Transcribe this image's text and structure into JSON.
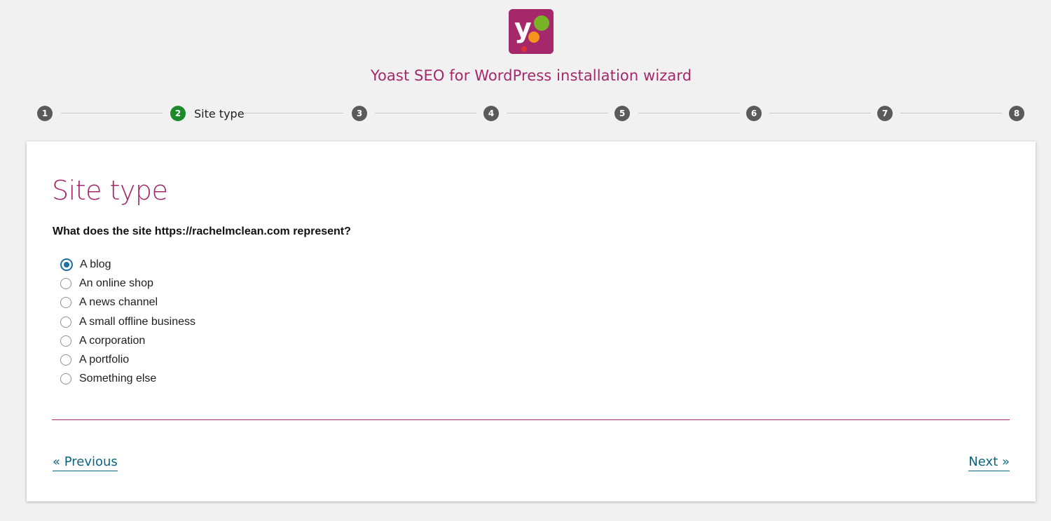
{
  "header": {
    "title": "Yoast SEO for WordPress installation wizard",
    "logo_icon": "yoast-logo-icon",
    "brand_color": "#a4286a"
  },
  "stepper": {
    "steps": [
      {
        "number": "1",
        "label": ""
      },
      {
        "number": "2",
        "label": "Site type",
        "active": true
      },
      {
        "number": "3",
        "label": ""
      },
      {
        "number": "4",
        "label": ""
      },
      {
        "number": "5",
        "label": ""
      },
      {
        "number": "6",
        "label": ""
      },
      {
        "number": "7",
        "label": ""
      },
      {
        "number": "8",
        "label": ""
      }
    ],
    "active_color": "#1b8a29",
    "inactive_color": "#5a5a5a"
  },
  "card": {
    "title": "Site type",
    "question": "What does the site https://rachelmclean.com represent?",
    "options": [
      {
        "label": "A blog",
        "selected": true
      },
      {
        "label": "An online shop",
        "selected": false
      },
      {
        "label": "A news channel",
        "selected": false
      },
      {
        "label": "A small offline business",
        "selected": false
      },
      {
        "label": "A corporation",
        "selected": false
      },
      {
        "label": "A portfolio",
        "selected": false
      },
      {
        "label": "Something else",
        "selected": false
      }
    ],
    "previous_label": "« Previous",
    "next_label": "Next »",
    "link_color": "#0a6580",
    "radio_color": "#1c6ea4"
  }
}
